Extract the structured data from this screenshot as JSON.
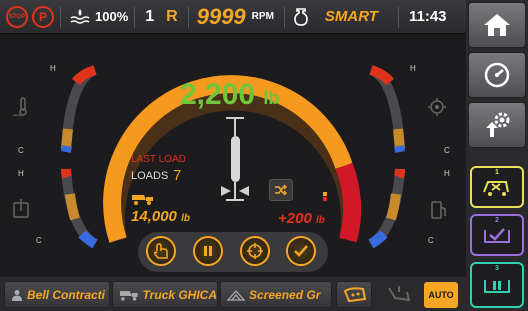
{
  "status_bar": {
    "stop_label": "STOP",
    "park_label": "P",
    "fluid_percent": "100%",
    "gear_number": "1",
    "gear_direction": "R",
    "rpm_value": "9999",
    "rpm_unit": "RPM",
    "mode": "SMART",
    "time": "11:43"
  },
  "main": {
    "load_value": "2,200",
    "load_unit": "lb",
    "last_load_label": "LAST LOAD",
    "loads_label": "LOADS",
    "loads_value": "7",
    "total_weight": "14,000",
    "total_weight_unit": "lb",
    "delta_weight": "+200",
    "delta_weight_unit": "lb",
    "left_gauges": [
      {
        "icon": "coolant-temp-icon",
        "high_label": "H",
        "low_label": "C"
      },
      {
        "icon": "oil-temp-icon",
        "high_label": "H",
        "low_label": "C"
      }
    ],
    "right_gauges": [
      {
        "icon": "transmission-temp-icon",
        "high_label": "H",
        "low_label": "C"
      },
      {
        "icon": "fuel-icon",
        "high_label": "H",
        "low_label": "C"
      }
    ],
    "actions": [
      {
        "icon": "hand-tap-icon"
      },
      {
        "icon": "pause-icon"
      },
      {
        "icon": "target-icon"
      },
      {
        "icon": "check-icon"
      }
    ]
  },
  "nav": {
    "buttons": [
      "home-icon",
      "speedometer-icon",
      "settings-icon"
    ],
    "quick": [
      {
        "number": "1",
        "icon": "truck-cancel-icon",
        "color": "#e8e05a"
      },
      {
        "number": "2",
        "icon": "check-icon",
        "color": "#9a6fe0"
      },
      {
        "number": "3",
        "icon": "pause-icon",
        "color": "#2fd0b0"
      }
    ]
  },
  "bottom_bar": {
    "operator": "Bell Contracti",
    "truck": "Truck GHICA",
    "material": "Screened Gr",
    "auto_label": "AUTO"
  },
  "colors": {
    "accent": "#f5a623",
    "load_green": "#6ec63a",
    "alert_red": "#e0331c"
  }
}
